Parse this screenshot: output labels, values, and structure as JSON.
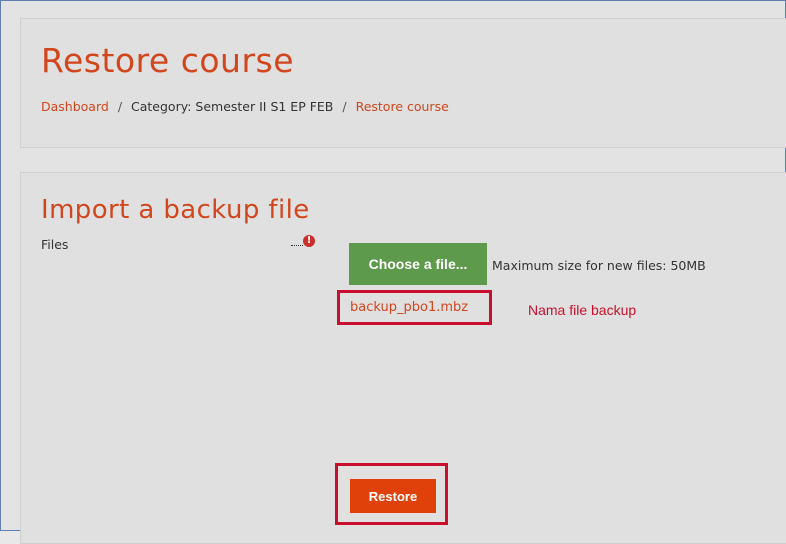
{
  "header": {
    "title": "Restore course",
    "breadcrumb": {
      "items": [
        "Dashboard",
        "Category: Semester II S1 EP FEB",
        "Restore course"
      ],
      "separator": "/"
    }
  },
  "import_section": {
    "title": "Import a backup file",
    "files_label": "Files",
    "required_icon": "!",
    "choose_file_label": "Choose a file...",
    "max_size_text": "Maximum size for new files: 50MB",
    "selected_file": "backup_pbo1.mbz",
    "annotation": "Nama file backup",
    "restore_label": "Restore"
  },
  "colors": {
    "accent": "#d1461c",
    "choose_button": "#5e9a4c",
    "restore_button": "#e0410a",
    "annotation_red": "#c8102e",
    "required_icon": "#c9302c"
  }
}
